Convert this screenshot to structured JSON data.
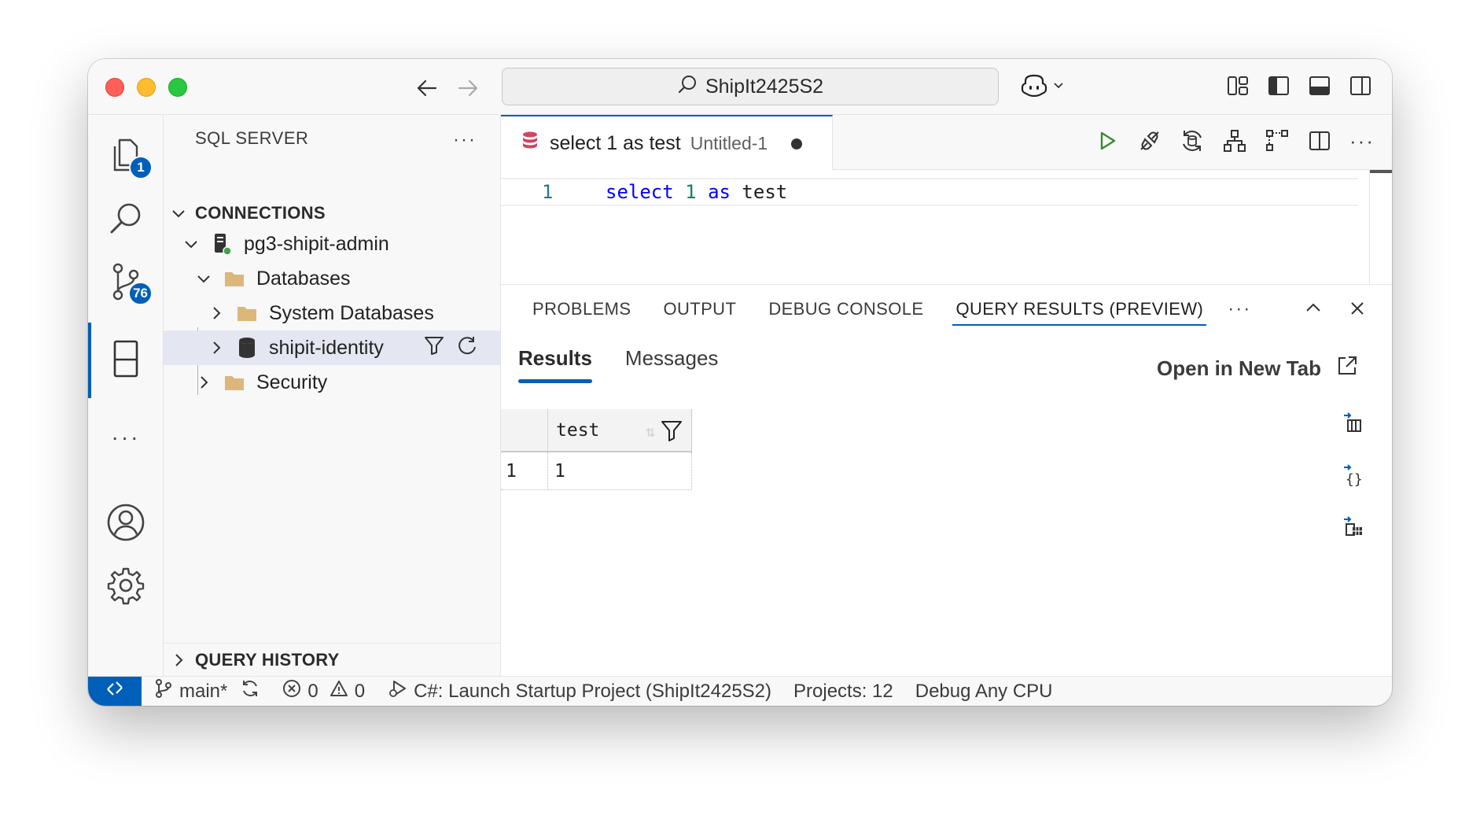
{
  "titlebar": {
    "search_text": "ShipIt2425S2"
  },
  "activity_bar": {
    "explorer_badge": "1",
    "scm_badge": "76"
  },
  "sidebar": {
    "title": "SQL SERVER",
    "more": "···",
    "connections_title": "CONNECTIONS",
    "tree": [
      {
        "label": "pg3-shipit-admin"
      },
      {
        "label": "Databases"
      },
      {
        "label": "System Databases"
      },
      {
        "label": "shipit-identity"
      },
      {
        "label": "Security"
      }
    ],
    "query_history_title": "QUERY HISTORY"
  },
  "editor": {
    "tab": {
      "title": "select 1 as test",
      "description": "Untitled-1"
    },
    "more": "···",
    "line_number": "1",
    "code": {
      "kw1": "select",
      "num": "1",
      "kw2": "as",
      "ident": "test"
    }
  },
  "panel": {
    "tabs": [
      "PROBLEMS",
      "OUTPUT",
      "DEBUG CONSOLE",
      "QUERY RESULTS (PREVIEW)"
    ],
    "more": "···",
    "results_tabs": [
      "Results",
      "Messages"
    ],
    "open_new_tab": "Open in New Tab",
    "grid": {
      "columns": [
        "test"
      ],
      "rows": [
        {
          "rownum": "1",
          "cells": [
            "1"
          ]
        }
      ]
    }
  },
  "statusbar": {
    "branch": "main*",
    "errors": "0",
    "warnings": "0",
    "launch": "C#: Launch Startup Project (ShipIt2425S2)",
    "projects": "Projects: 12",
    "config": "Debug Any CPU"
  },
  "colors": {
    "accent": "#005fb8",
    "folder": "#dcb67a",
    "run_green": "#388a34",
    "keyword": "#0000ff",
    "number": "#098658"
  }
}
